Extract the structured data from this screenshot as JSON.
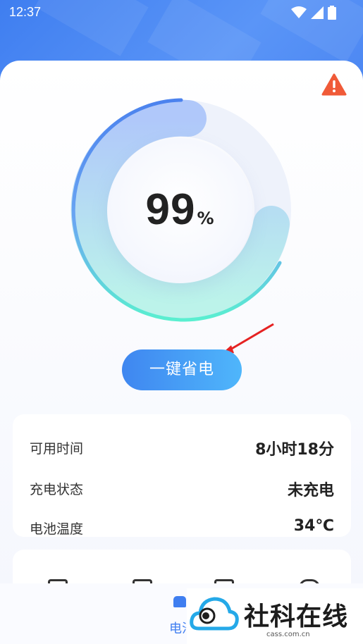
{
  "status_bar": {
    "time": "12:37"
  },
  "battery": {
    "level": "99",
    "unit": "%"
  },
  "actions": {
    "save_label": "一键省电"
  },
  "info": [
    {
      "label": "可用时间",
      "value": "8小时18分"
    },
    {
      "label": "充电状态",
      "value": "未充电"
    },
    {
      "label": "电池温度",
      "value": "34℃"
    }
  ],
  "nav": {
    "active_tab": "电池"
  },
  "watermark": {
    "title": "社科在线",
    "sub": "cass.com.cn"
  },
  "colors": {
    "accent": "#3f7ef0",
    "warning": "#f05a38",
    "gauge_start": "#5aefd0",
    "gauge_end": "#4b82ee"
  }
}
